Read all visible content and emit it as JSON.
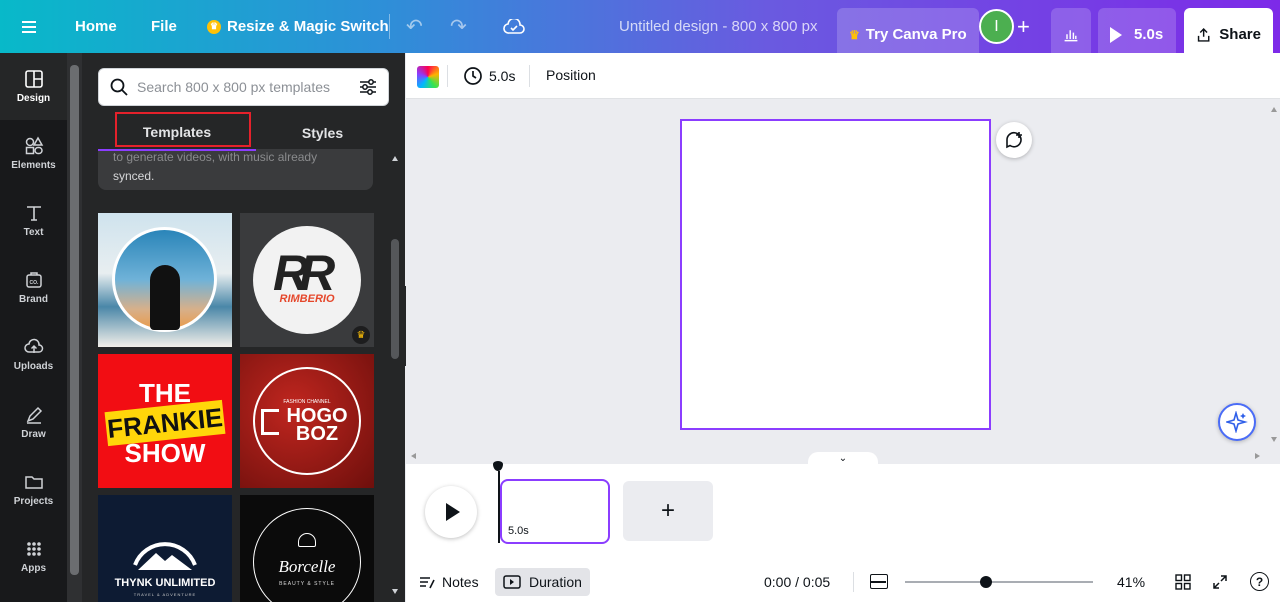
{
  "topbar": {
    "home": "Home",
    "file": "File",
    "resize": "Resize & Magic Switch",
    "title": "Untitled design - 800 x 800 px",
    "try_pro": "Try Canva Pro",
    "avatar_initial": "I",
    "play_duration": "5.0s",
    "share": "Share"
  },
  "sidebar": {
    "items": [
      {
        "label": "Design",
        "icon": "design-icon"
      },
      {
        "label": "Elements",
        "icon": "elements-icon"
      },
      {
        "label": "Text",
        "icon": "text-icon"
      },
      {
        "label": "Brand",
        "icon": "brand-icon"
      },
      {
        "label": "Uploads",
        "icon": "uploads-icon"
      },
      {
        "label": "Draw",
        "icon": "draw-icon"
      },
      {
        "label": "Projects",
        "icon": "projects-icon"
      },
      {
        "label": "Apps",
        "icon": "apps-icon"
      }
    ]
  },
  "panel": {
    "search_placeholder": "Search 800 x 800 px templates",
    "tabs": [
      "Templates",
      "Styles"
    ],
    "info_text_1": "to generate videos, with music already",
    "info_text_2": "synced.",
    "templates": [
      {
        "id": "photo-silhouette"
      },
      {
        "id": "rimberio",
        "text": "RIMBERIO"
      },
      {
        "id": "frankie",
        "line1": "THE",
        "line2": "FRANKIE",
        "line3": "SHOW"
      },
      {
        "id": "hogo",
        "small": "FASHION CHANNEL",
        "line1": "HOGO",
        "line2": "BOZ"
      },
      {
        "id": "thynk",
        "line1": "THYNK UNLIMITED",
        "line2": "TRAVEL & ADVENTURE"
      },
      {
        "id": "borcelle",
        "line1": "Borcelle",
        "line2": "BEAUTY & STYLE"
      }
    ]
  },
  "context_bar": {
    "duration": "5.0s",
    "position": "Position"
  },
  "timeline": {
    "clip_duration": "5.0s",
    "time": "0:00 / 0:05",
    "notes": "Notes",
    "duration": "Duration",
    "zoom": "41%",
    "zoom_fraction": 0.43
  },
  "colors": {
    "accent": "#8b3dff",
    "highlight_box": "#e5212b",
    "avatar": "#4caf50"
  }
}
